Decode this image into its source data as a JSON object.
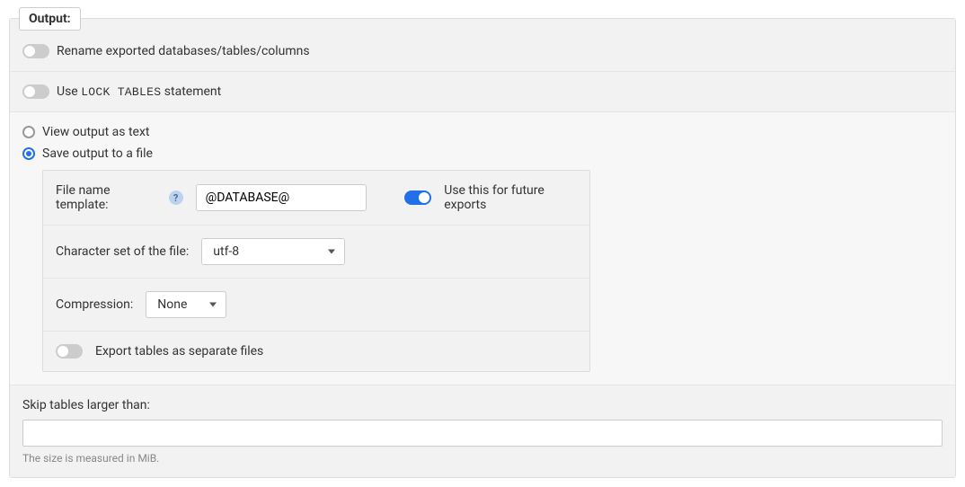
{
  "legend": "Output:",
  "rename_toggle": {
    "checked": false,
    "label": "Rename exported databases/tables/columns"
  },
  "lock_tables": {
    "checked": false,
    "prefix": "Use ",
    "code": "LOCK TABLES",
    "suffix": " statement"
  },
  "output_mode": {
    "view_text": {
      "label": "View output as text",
      "checked": false
    },
    "save_file": {
      "label": "Save output to a file",
      "checked": true
    }
  },
  "file_panel": {
    "filename": {
      "label": "File name template:",
      "value": "@DATABASE@"
    },
    "future": {
      "checked": true,
      "label": "Use this for future exports"
    },
    "charset": {
      "label": "Character set of the file:",
      "value": "utf-8"
    },
    "compression": {
      "label": "Compression:",
      "value": "None"
    },
    "separate": {
      "checked": false,
      "label": "Export tables as separate files"
    }
  },
  "skip": {
    "label": "Skip tables larger than:",
    "value": "",
    "hint": "The size is measured in MiB."
  }
}
